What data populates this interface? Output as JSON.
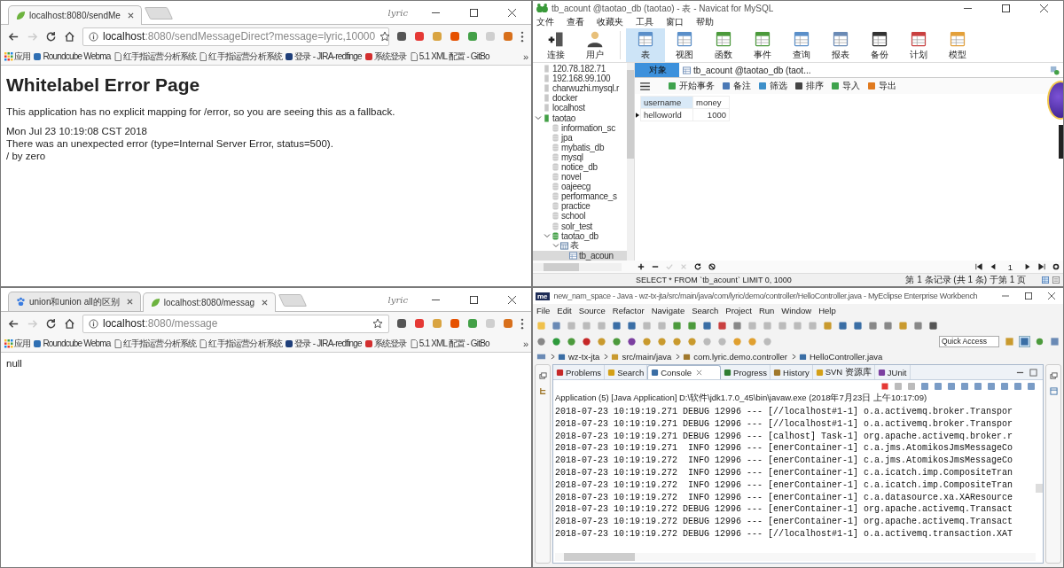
{
  "browser_top": {
    "kind": "error_page",
    "profile": "lyric",
    "tabs": [
      {
        "label": "localhost:8080/sendMe",
        "kind": "leaf",
        "selected": true
      }
    ],
    "address": {
      "host": "localhost",
      "rest": ":8080/sendMessageDirect?message=lyric,10000"
    },
    "bookmarks": [
      {
        "label": "应用",
        "kind": "apps"
      },
      {
        "label": "Roundcube Webma",
        "kind": "globe"
      },
      {
        "label": "红手指运营分析系统",
        "kind": "page"
      },
      {
        "label": "红手指运营分析系统",
        "kind": "page"
      },
      {
        "label": "登录 - JIRA-redfinge",
        "kind": "jira"
      },
      {
        "label": "系统登录",
        "kind": "red"
      },
      {
        "label": "5.1 XML 配置 - GitBo",
        "kind": "page"
      }
    ],
    "overflow": "»",
    "page": {
      "heading": "Whitelabel Error Page",
      "intro": "This application has no explicit mapping for /error, so you are seeing this as a fallback.",
      "details": [
        "Mon Jul 23 10:19:08 CST 2018",
        "There was an unexpected error (type=Internal Server Error, status=500).",
        "/ by zero"
      ]
    }
  },
  "navicat": {
    "title": "tb_acount @taotao_db (taotao) - 表 - Navicat for MySQL",
    "menu": [
      "文件",
      "查看",
      "收藏夹",
      "工具",
      "窗口",
      "帮助"
    ],
    "ribbon": [
      {
        "label": "连接",
        "kind": "connect",
        "selected": false
      },
      {
        "label": "用户",
        "kind": "user",
        "selected": false
      },
      {
        "label": "表",
        "kind": "table",
        "selected": true
      },
      {
        "label": "视图",
        "kind": "view",
        "selected": false
      },
      {
        "label": "函数",
        "kind": "function",
        "selected": false
      },
      {
        "label": "事件",
        "kind": "event",
        "selected": false
      },
      {
        "label": "查询",
        "kind": "query",
        "selected": false
      },
      {
        "label": "报表",
        "kind": "report",
        "selected": false
      },
      {
        "label": "备份",
        "kind": "backup",
        "selected": false
      },
      {
        "label": "计划",
        "kind": "schedule",
        "selected": false
      },
      {
        "label": "模型",
        "kind": "model",
        "selected": false
      }
    ],
    "tree": [
      {
        "label": "120.78.182.71",
        "kind": "connection",
        "expanded": false,
        "selected": false
      },
      {
        "label": "192.168.99.100",
        "kind": "connection",
        "expanded": false,
        "selected": false
      },
      {
        "label": "charwuzhi.mysql.r",
        "kind": "connection",
        "expanded": false,
        "selected": false
      },
      {
        "label": "docker",
        "kind": "connection",
        "expanded": false,
        "selected": false
      },
      {
        "label": "localhost",
        "kind": "connection",
        "expanded": false,
        "selected": false
      },
      {
        "label": "taotao",
        "kind": "connection",
        "expanded": true,
        "selected": false,
        "children": [
          {
            "label": "information_sc",
            "kind": "database",
            "expanded": false,
            "selected": false
          },
          {
            "label": "jpa",
            "kind": "database",
            "expanded": false,
            "selected": false
          },
          {
            "label": "mybatis_db",
            "kind": "database",
            "expanded": false,
            "selected": false
          },
          {
            "label": "mysql",
            "kind": "database",
            "expanded": false,
            "selected": false
          },
          {
            "label": "notice_db",
            "kind": "database",
            "expanded": false,
            "selected": false
          },
          {
            "label": "novel",
            "kind": "database",
            "expanded": false,
            "selected": false
          },
          {
            "label": "oajeecg",
            "kind": "database",
            "expanded": false,
            "selected": false
          },
          {
            "label": "performance_s",
            "kind": "database",
            "expanded": false,
            "selected": false
          },
          {
            "label": "practice",
            "kind": "database",
            "expanded": false,
            "selected": false
          },
          {
            "label": "school",
            "kind": "database",
            "expanded": false,
            "selected": false
          },
          {
            "label": "solr_test",
            "kind": "database",
            "expanded": false,
            "selected": false
          },
          {
            "label": "taotao_db",
            "kind": "database",
            "expanded": true,
            "selected": false,
            "children": [
              {
                "label": "表",
                "kind": "folder",
                "expanded": true,
                "selected": false,
                "children": [
                  {
                    "label": "tb_acoun",
                    "kind": "table",
                    "expanded": false,
                    "selected": true
                  }
                ]
              }
            ]
          }
        ]
      }
    ],
    "object_tabs": [
      {
        "label": "对象",
        "selected": true
      },
      {
        "label": "tb_acount @taotao_db (taot...",
        "selected": false
      }
    ],
    "actions": [
      {
        "label": "开始事务",
        "kind": "begin"
      },
      {
        "label": "备注",
        "kind": "memo"
      },
      {
        "label": "筛选",
        "kind": "filter"
      },
      {
        "label": "排序",
        "kind": "sort"
      },
      {
        "label": "导入",
        "kind": "import"
      },
      {
        "label": "导出",
        "kind": "export"
      }
    ],
    "grid": {
      "columns": [
        "username",
        "money"
      ],
      "rows": [
        [
          "helloworld",
          "1000"
        ]
      ]
    },
    "page_number": "1",
    "sql": "SELECT * FROM `tb_acount` LIMIT 0, 1000",
    "record_info": "第 1 条记录 (共 1 条) 于第 1 页"
  },
  "browser_bottom": {
    "kind": "plain_text",
    "profile": "lyric",
    "tabs": [
      {
        "label": "union和union all的区别",
        "kind": "paw",
        "selected": false
      },
      {
        "label": "localhost:8080/messag",
        "kind": "leaf",
        "selected": true
      }
    ],
    "address": {
      "host": "localhost",
      "rest": ":8080/message"
    },
    "bookmarks": [
      {
        "label": "应用",
        "kind": "apps"
      },
      {
        "label": "Roundcube Webma",
        "kind": "globe"
      },
      {
        "label": "红手指运营分析系统",
        "kind": "page"
      },
      {
        "label": "红手指运营分析系统",
        "kind": "page"
      },
      {
        "label": "登录 - JIRA-redfinge",
        "kind": "jira"
      },
      {
        "label": "系统登录",
        "kind": "red"
      },
      {
        "label": "5.1 XML 配置 - GitBo",
        "kind": "page"
      }
    ],
    "overflow": "»",
    "page": {
      "text": "null"
    }
  },
  "myeclipse": {
    "logo": "me",
    "title": "new_nam_space - Java - wz-tx-jta/src/main/java/com/lyric/demo/controller/HelloController.java - MyEclipse Enterprise Workbench",
    "menu": [
      "File",
      "Edit",
      "Source",
      "Refactor",
      "Navigate",
      "Search",
      "Project",
      "Run",
      "Window",
      "Help"
    ],
    "quick_access": {
      "placeholder": "Quick Access"
    },
    "breadcrumb": [
      {
        "label": "wz-tx-jta",
        "kind": "project"
      },
      {
        "label": "src/main/java",
        "kind": "source"
      },
      {
        "label": "com.lyric.demo.controller",
        "kind": "package"
      },
      {
        "label": "HelloController.java",
        "kind": "file"
      }
    ],
    "view_tabs": [
      {
        "label": "Problems",
        "kind": "problems",
        "selected": false
      },
      {
        "label": "Search",
        "kind": "search",
        "selected": false
      },
      {
        "label": "Console",
        "kind": "console",
        "selected": true
      },
      {
        "label": "Progress",
        "kind": "progress",
        "selected": false
      },
      {
        "label": "History",
        "kind": "history",
        "selected": false
      },
      {
        "label": "SVN 资源库",
        "kind": "svn",
        "selected": false
      },
      {
        "label": "JUnit",
        "kind": "junit",
        "selected": false
      }
    ],
    "console": {
      "header": "Application (5) [Java Application] D:\\软件\\jdk1.7.0_45\\bin\\javaw.exe (2018年7月23日 上午10:17:09)",
      "lines": [
        "2018-07-23 10:19:19.271 DEBUG 12996 --- [//localhost#1-1] o.a.activemq.broker.Transpor",
        "2018-07-23 10:19:19.271 DEBUG 12996 --- [//localhost#1-1] o.a.activemq.broker.Transpor",
        "2018-07-23 10:19:19.271 DEBUG 12996 --- [calhost] Task-1] org.apache.activemq.broker.r",
        "2018-07-23 10:19:19.271  INFO 12996 --- [enerContainer-1] c.a.jms.AtomikosJmsMessageCo",
        "2018-07-23 10:19:19.272  INFO 12996 --- [enerContainer-1] c.a.jms.AtomikosJmsMessageCo",
        "2018-07-23 10:19:19.272  INFO 12996 --- [enerContainer-1] c.a.icatch.imp.CompositeTran",
        "2018-07-23 10:19:19.272  INFO 12996 --- [enerContainer-1] c.a.icatch.imp.CompositeTran",
        "2018-07-23 10:19:19.272  INFO 12996 --- [enerContainer-1] c.a.datasource.xa.XAResource",
        "2018-07-23 10:19:19.272 DEBUG 12996 --- [enerContainer-1] org.apache.activemq.Transact",
        "2018-07-23 10:19:19.272 DEBUG 12996 --- [enerContainer-1] org.apache.activemq.Transact",
        "2018-07-23 10:19:19.272 DEBUG 12996 --- [//localhost#1-1] o.a.activemq.transaction.XAT"
      ]
    }
  }
}
